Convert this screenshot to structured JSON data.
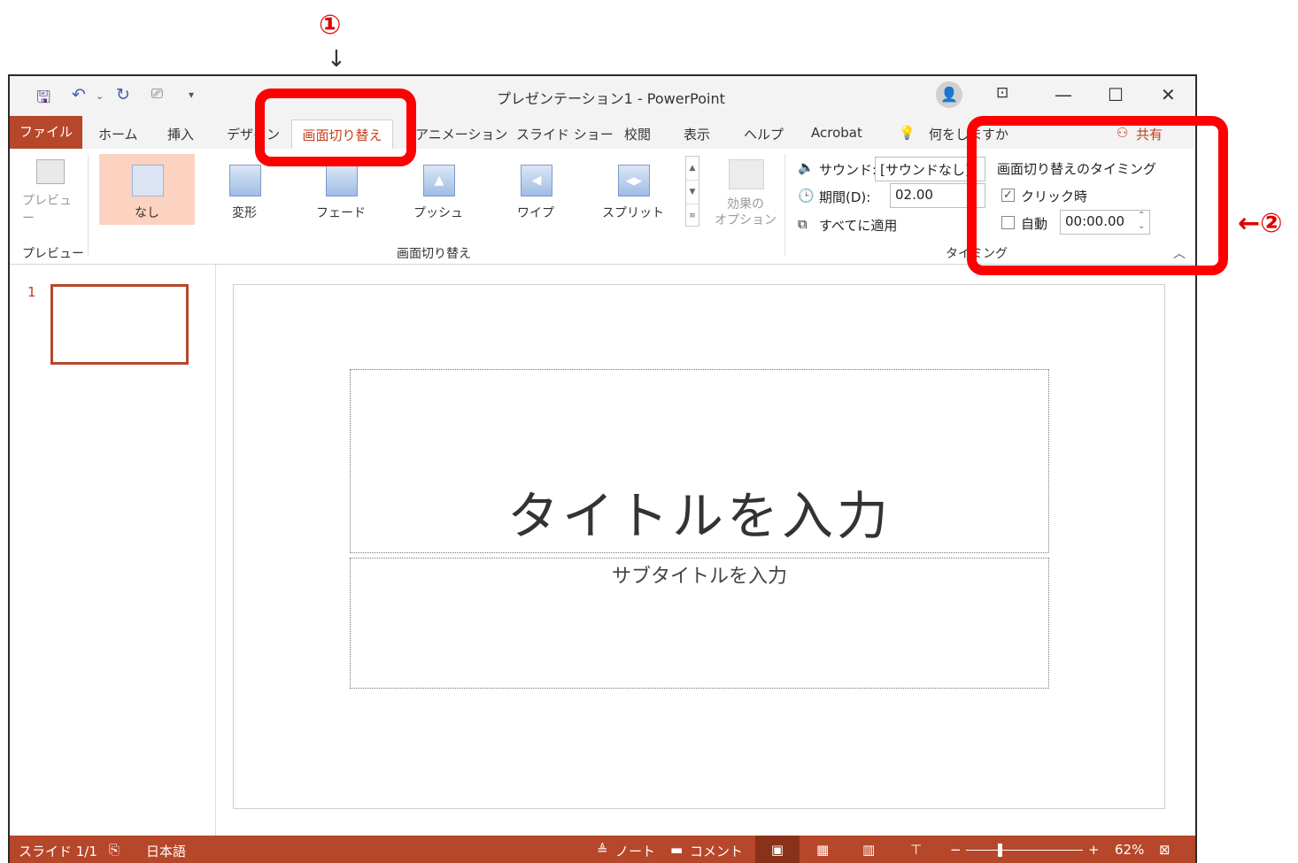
{
  "annotations": {
    "label1": "①",
    "label2": "←②"
  },
  "window": {
    "title": "プレゼンテーション1 - PowerPoint"
  },
  "tabs": {
    "file": "ファイル",
    "home": "ホーム",
    "insert": "挿入",
    "design": "デザイン",
    "transitions": "画面切り替え",
    "animations": "アニメーション",
    "slideshow": "スライド ショー",
    "review": "校閲",
    "view": "表示",
    "help": "ヘルプ",
    "acrobat": "Acrobat",
    "tellme": "何をしますか",
    "share": "共有"
  },
  "ribbon": {
    "preview": {
      "button": "プレビュー",
      "group_label": "プレビュー"
    },
    "gallery": {
      "items": [
        "なし",
        "変形",
        "フェード",
        "プッシュ",
        "ワイプ",
        "スプリット"
      ],
      "selected": "なし",
      "effect_options": [
        "効果の",
        "オプション"
      ],
      "group_label": "画面切り替え"
    },
    "timing": {
      "sound_label": "サウンド:",
      "sound_value": "[サウンドなし]",
      "duration_label": "期間(D):",
      "duration_value": "02.00",
      "apply_all": "すべてに適用",
      "heading": "画面切り替えのタイミング",
      "on_click": "クリック時",
      "on_click_checked": true,
      "auto": "自動",
      "auto_value": "00:00.00",
      "group_label": "タイミング"
    }
  },
  "thumbnails": {
    "slide_number": "1"
  },
  "slide": {
    "title_placeholder": "タイトルを入力",
    "subtitle_placeholder": "サブタイトルを入力"
  },
  "status": {
    "slide_count": "スライド 1/1",
    "language": "日本語",
    "notes": "ノート",
    "comments": "コメント",
    "zoom": "62%"
  },
  "colors": {
    "accent": "#b7472a",
    "annotation": "#ff0000"
  }
}
